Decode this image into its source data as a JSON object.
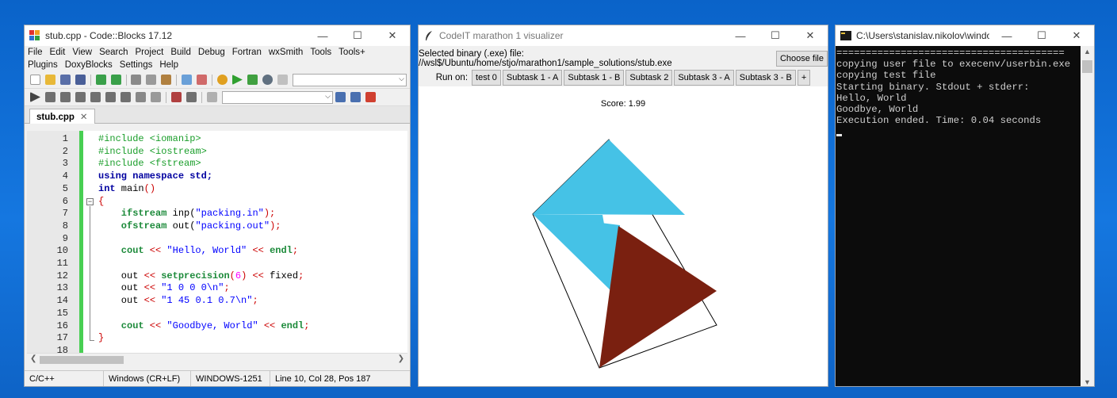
{
  "codeblocks": {
    "title": "stub.cpp - Code::Blocks 17.12",
    "window_controls": [
      "—",
      "☐",
      "✕"
    ],
    "menu": [
      "File",
      "Edit",
      "View",
      "Search",
      "Project",
      "Build",
      "Debug",
      "Fortran",
      "wxSmith",
      "Tools",
      "Tools+",
      "Plugins",
      "DoxyBlocks",
      "Settings",
      "Help"
    ],
    "tab_label": "stub.cpp",
    "tab_close": "✕",
    "line_numbers": [
      "1",
      "2",
      "3",
      "4",
      "5",
      "6",
      "7",
      "8",
      "9",
      "10",
      "11",
      "12",
      "13",
      "14",
      "15",
      "16",
      "17",
      "18"
    ],
    "code": {
      "l1": "#include <iomanip>",
      "l2": "#include <iostream>",
      "l3": "#include <fstream>",
      "l4a": "using namespace",
      "l4b": " std;",
      "l5a": "int",
      "l5b": " main",
      "l5c": "()",
      "l6": "{",
      "l7a": "    ifstream",
      "l7b": " inp(",
      "l7c": "\"packing.in\"",
      "l7d": ");",
      "l8a": "    ofstream",
      "l8b": " out(",
      "l8c": "\"packing.out\"",
      "l8d": ");",
      "l10a": "    cout",
      "l10b": " << ",
      "l10c": "\"Hello, World\"",
      "l10d": " << ",
      "l10e": "endl",
      "l10f": ";",
      "l12a": "    out",
      "l12b": " << ",
      "l12c": "setprecision",
      "l12d": "(",
      "l12e": "6",
      "l12f": ")",
      "l12g": " << ",
      "l12h": "fixed",
      "l12i": ";",
      "l13a": "    out",
      "l13b": " << ",
      "l13c": "\"1 0 0 0\\n\"",
      "l13d": ";",
      "l14a": "    out",
      "l14b": " << ",
      "l14c": "\"1 45 0.1 0.7\\n\"",
      "l14d": ";",
      "l16a": "    cout",
      "l16b": " << ",
      "l16c": "\"Goodbye, World\"",
      "l16d": " << ",
      "l16e": "endl",
      "l16f": ";",
      "l17": "}"
    },
    "status": {
      "language": "C/C++",
      "line_endings": "Windows (CR+LF)",
      "encoding": "WINDOWS-1251",
      "position": "Line 10, Col 28, Pos 187"
    }
  },
  "visualizer": {
    "title": "CodeIT marathon 1 visualizer",
    "window_controls": [
      "—",
      "☐",
      "✕"
    ],
    "binary_label": "Selected binary (.exe) file: //wsl$/Ubuntu/home/stjo/marathon1/sample_solutions/stub.exe",
    "choose_file": "Choose file",
    "run_on_label": "Run on:",
    "run_buttons": [
      "test 0",
      "Subtask 1 - A",
      "Subtask 1 - B",
      "Subtask 2",
      "Subtask 3 - A",
      "Subtask 3 - B",
      "+"
    ],
    "score": "Score: 1.99",
    "colors": {
      "blue": "#45c2e6",
      "brown": "#7a2010"
    }
  },
  "console": {
    "title": "C:\\Users\\stanislav.nikolov\\windows_...",
    "window_controls": [
      "—",
      "☐",
      "✕"
    ],
    "lines": [
      "=======================================",
      "copying user file to execenv/userbin.exe",
      "copying test file",
      "Starting binary. Stdout + stderr:",
      "Hello, World",
      "Goodbye, World",
      "Execution ended. Time: 0.04 seconds"
    ]
  }
}
